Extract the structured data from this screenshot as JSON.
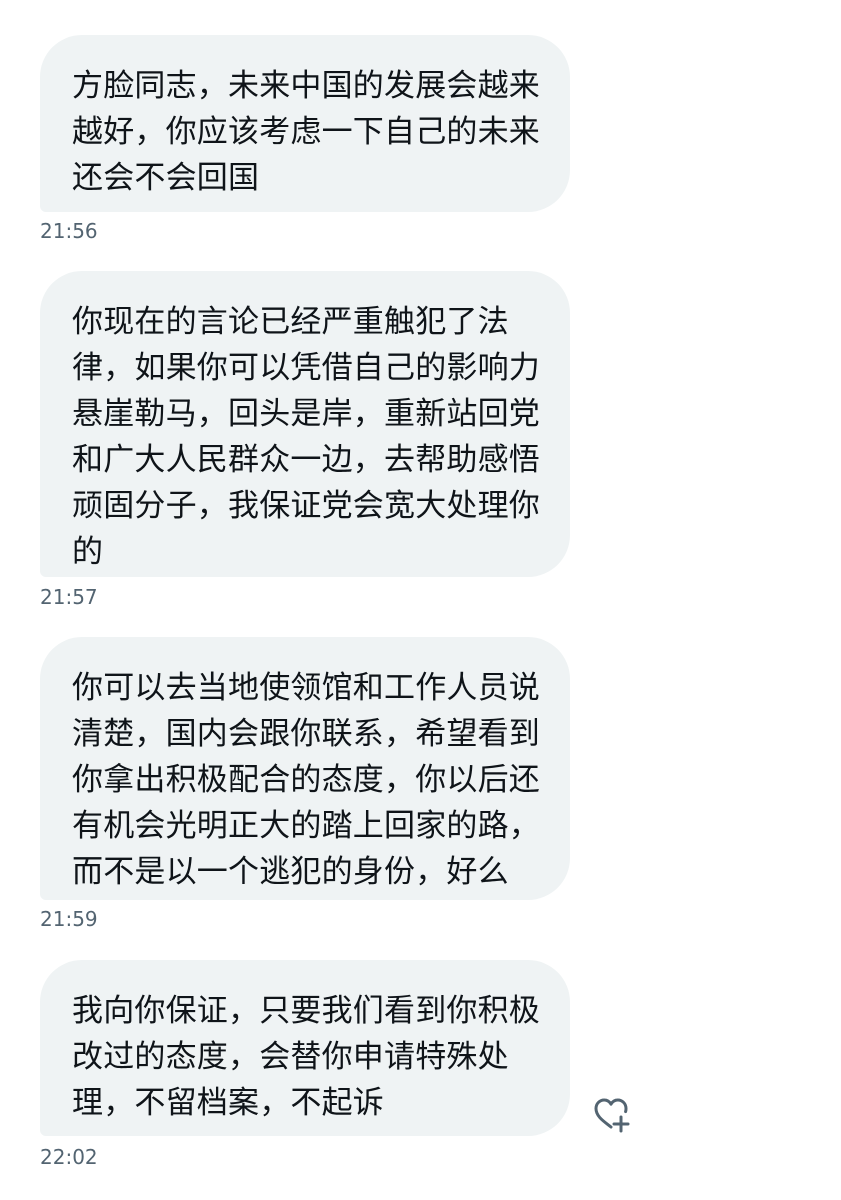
{
  "messages": [
    {
      "lines": [
        "方脸同志，未来中国的发展会越来",
        "越好，你应该考虑一下自己的未来",
        "还会不会回国"
      ],
      "time": "21:56"
    },
    {
      "lines": [
        "你现在的言论已经严重触犯了法",
        "律，如果你可以凭借自己的影响力",
        "悬崖勒马，回头是岸，重新站回党",
        "和广大人民群众一边，去帮助感悟",
        "顽固分子，我保证党会宽大处理你",
        "的"
      ],
      "time": "21:57"
    },
    {
      "lines": [
        "你可以去当地使领馆和工作人员说",
        "清楚，国内会跟你联系，希望看到",
        "你拿出积极配合的态度，你以后还",
        "有机会光明正大的踏上回家的路，",
        "而不是以一个逃犯的身份，好么"
      ],
      "time": "21:59"
    },
    {
      "lines": [
        "我向你保证，只要我们看到你积极",
        "改过的态度，会替你申请特殊处",
        "理，不留档案，不起诉"
      ],
      "time": "22:02"
    }
  ],
  "reaction_button": {
    "icon": "heart-plus-icon"
  },
  "colors": {
    "bubble_background": "#eff3f4",
    "message_text": "#0f1419",
    "timestamp_text": "#536471",
    "icon_stroke": "#536471"
  }
}
